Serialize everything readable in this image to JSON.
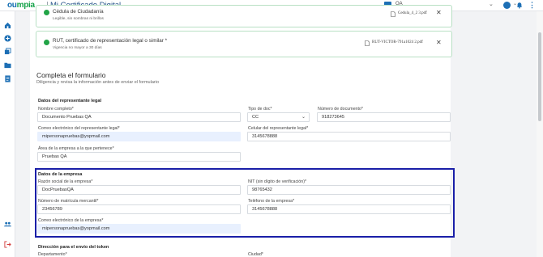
{
  "topbar": {
    "logo_main": "ou",
    "logo_rest": "mpia",
    "app_title": "Mi Certificado Digital",
    "org_name": "QA",
    "chevron": "⌄",
    "user_chevron": "⌄",
    "more": "⋮"
  },
  "documents": [
    {
      "title": "Cédula de Ciudadanía",
      "subtitle": "Legible, sin sombras ni brillos",
      "file": "Cedula_4_2 3.pdf"
    },
    {
      "title": "RUT, certificado de representación legal o similar *",
      "subtitle": "Vigencia no mayor a 30 días",
      "file": "RUT-VICTOR-791a1024 2.pdf"
    }
  ],
  "form": {
    "title": "Completa el formulario",
    "subtitle": "Diligencia y revisa la información antes de enviar el formulario"
  },
  "representative": {
    "section": "Datos del representante legal",
    "name_label": "Nombre completo*",
    "name_value": "Documento Pruebas QA",
    "doc_type_label": "Tipo de doc*",
    "doc_type_value": "CC",
    "doc_number_label": "Número de documento*",
    "doc_number_value": "918273645",
    "email_label": "Correo electrónico del representante legal*",
    "email_value": "mipersonapruebas@yopmail.com",
    "phone_label": "Celular del representante legal*",
    "phone_value": "3145678888",
    "area_label": "Área de la empresa a la que pertenece*",
    "area_value": "Pruebas QA"
  },
  "company": {
    "section": "Datos de la empresa",
    "name_label": "Razón social de la empresa*",
    "name_value": "DocPruebasQA",
    "nit_label": "NIT (sin dígito de verificación)*",
    "nit_value": "98765432",
    "reg_label": "Número de matrícula mercantil*",
    "reg_value": "23456789",
    "phone_label": "Teléfono de la empresa*",
    "phone_value": "3145678888",
    "email_label": "Correo electrónico de la empresa*",
    "email_value": "mipersonapruebas@yopmail.com"
  },
  "token": {
    "section": "Dirección para el envío del token",
    "dept_label": "Departamento*",
    "city_label": "Ciudad*"
  },
  "icons": {
    "close": "✕",
    "dropdown": "⌄"
  },
  "colors": {
    "brand_green": "#16a34a",
    "brand_blue": "#1d6fb5",
    "highlight": "#1a1fa8"
  }
}
